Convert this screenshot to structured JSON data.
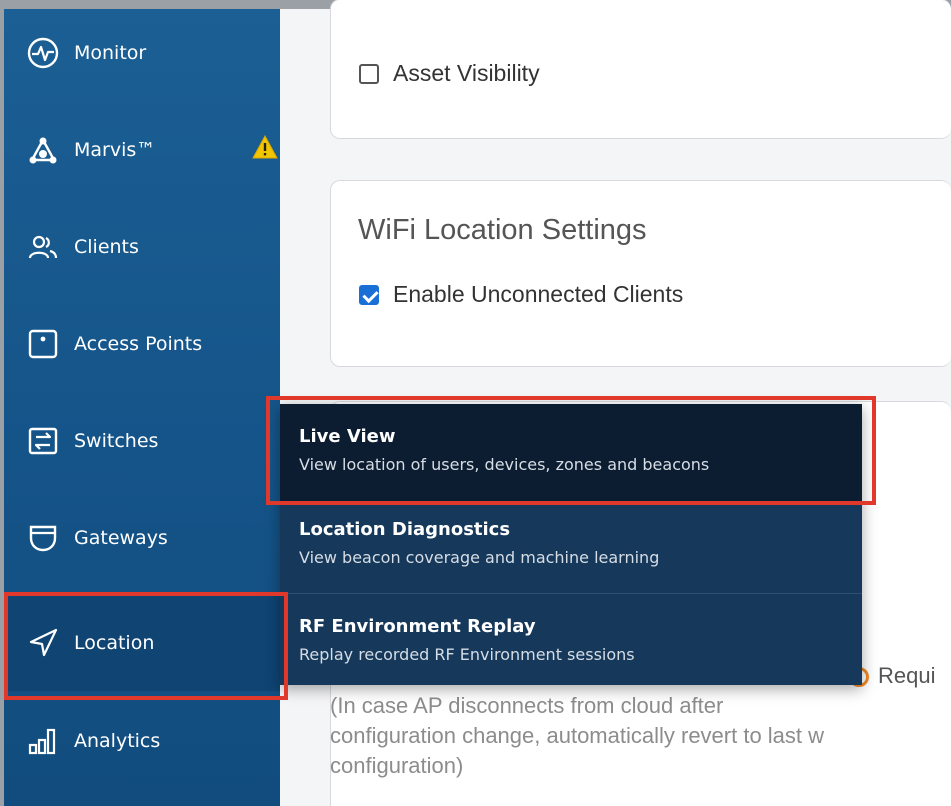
{
  "sidebar": {
    "items": [
      {
        "label": "Monitor",
        "icon": "pulse-icon"
      },
      {
        "label": "Marvis™",
        "icon": "marvis-icon",
        "badge": "warning-icon"
      },
      {
        "label": "Clients",
        "icon": "users-icon"
      },
      {
        "label": "Access Points",
        "icon": "access-point-icon"
      },
      {
        "label": "Switches",
        "icon": "switch-icon"
      },
      {
        "label": "Gateways",
        "icon": "gateway-icon"
      },
      {
        "label": "Location",
        "icon": "location-arrow-icon"
      },
      {
        "label": "Analytics",
        "icon": "analytics-icon"
      }
    ],
    "active": "Location"
  },
  "content": {
    "asset_visibility": {
      "label": "Asset Visibility",
      "checked": false
    },
    "wifi_location": {
      "title": "WiFi Location Settings",
      "unconnected": {
        "label": "Enable Unconnected Clients",
        "checked": true
      }
    },
    "config_revert": {
      "required_label": "Requi",
      "line1": "(In case AP disconnects from cloud after",
      "line2": "configuration change, automatically revert to last w",
      "line3": "configuration)"
    }
  },
  "location_menu": {
    "items": [
      {
        "title": "Live View",
        "subtitle": "View location of users, devices, zones and beacons"
      },
      {
        "title": "Location Diagnostics",
        "subtitle": "View beacon coverage and machine learning"
      },
      {
        "title": "RF Environment Replay",
        "subtitle": "Replay recorded RF Environment sessions"
      }
    ]
  },
  "colors": {
    "sidebar": "#155489",
    "dropdown": "#16385a",
    "highlight_outline": "#e0392b",
    "checkbox_checked": "#1a6fd6",
    "warning": "#f2c500"
  }
}
